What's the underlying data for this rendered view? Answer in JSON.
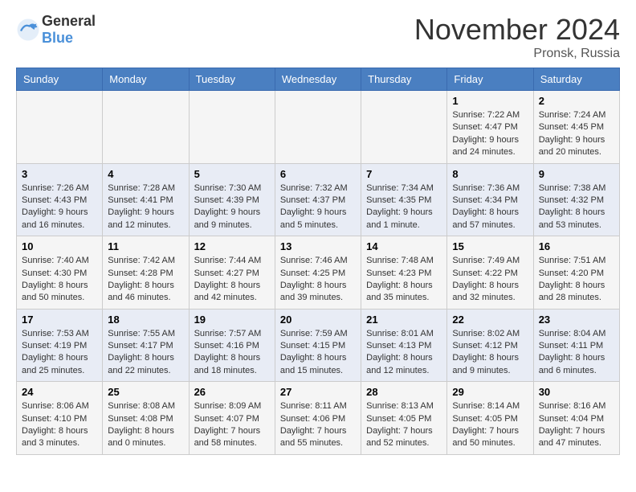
{
  "header": {
    "logo_general": "General",
    "logo_blue": "Blue",
    "month_title": "November 2024",
    "location": "Pronsk, Russia"
  },
  "days_of_week": [
    "Sunday",
    "Monday",
    "Tuesday",
    "Wednesday",
    "Thursday",
    "Friday",
    "Saturday"
  ],
  "weeks": [
    [
      {
        "day": "",
        "info": ""
      },
      {
        "day": "",
        "info": ""
      },
      {
        "day": "",
        "info": ""
      },
      {
        "day": "",
        "info": ""
      },
      {
        "day": "",
        "info": ""
      },
      {
        "day": "1",
        "info": "Sunrise: 7:22 AM\nSunset: 4:47 PM\nDaylight: 9 hours and 24 minutes."
      },
      {
        "day": "2",
        "info": "Sunrise: 7:24 AM\nSunset: 4:45 PM\nDaylight: 9 hours and 20 minutes."
      }
    ],
    [
      {
        "day": "3",
        "info": "Sunrise: 7:26 AM\nSunset: 4:43 PM\nDaylight: 9 hours and 16 minutes."
      },
      {
        "day": "4",
        "info": "Sunrise: 7:28 AM\nSunset: 4:41 PM\nDaylight: 9 hours and 12 minutes."
      },
      {
        "day": "5",
        "info": "Sunrise: 7:30 AM\nSunset: 4:39 PM\nDaylight: 9 hours and 9 minutes."
      },
      {
        "day": "6",
        "info": "Sunrise: 7:32 AM\nSunset: 4:37 PM\nDaylight: 9 hours and 5 minutes."
      },
      {
        "day": "7",
        "info": "Sunrise: 7:34 AM\nSunset: 4:35 PM\nDaylight: 9 hours and 1 minute."
      },
      {
        "day": "8",
        "info": "Sunrise: 7:36 AM\nSunset: 4:34 PM\nDaylight: 8 hours and 57 minutes."
      },
      {
        "day": "9",
        "info": "Sunrise: 7:38 AM\nSunset: 4:32 PM\nDaylight: 8 hours and 53 minutes."
      }
    ],
    [
      {
        "day": "10",
        "info": "Sunrise: 7:40 AM\nSunset: 4:30 PM\nDaylight: 8 hours and 50 minutes."
      },
      {
        "day": "11",
        "info": "Sunrise: 7:42 AM\nSunset: 4:28 PM\nDaylight: 8 hours and 46 minutes."
      },
      {
        "day": "12",
        "info": "Sunrise: 7:44 AM\nSunset: 4:27 PM\nDaylight: 8 hours and 42 minutes."
      },
      {
        "day": "13",
        "info": "Sunrise: 7:46 AM\nSunset: 4:25 PM\nDaylight: 8 hours and 39 minutes."
      },
      {
        "day": "14",
        "info": "Sunrise: 7:48 AM\nSunset: 4:23 PM\nDaylight: 8 hours and 35 minutes."
      },
      {
        "day": "15",
        "info": "Sunrise: 7:49 AM\nSunset: 4:22 PM\nDaylight: 8 hours and 32 minutes."
      },
      {
        "day": "16",
        "info": "Sunrise: 7:51 AM\nSunset: 4:20 PM\nDaylight: 8 hours and 28 minutes."
      }
    ],
    [
      {
        "day": "17",
        "info": "Sunrise: 7:53 AM\nSunset: 4:19 PM\nDaylight: 8 hours and 25 minutes."
      },
      {
        "day": "18",
        "info": "Sunrise: 7:55 AM\nSunset: 4:17 PM\nDaylight: 8 hours and 22 minutes."
      },
      {
        "day": "19",
        "info": "Sunrise: 7:57 AM\nSunset: 4:16 PM\nDaylight: 8 hours and 18 minutes."
      },
      {
        "day": "20",
        "info": "Sunrise: 7:59 AM\nSunset: 4:15 PM\nDaylight: 8 hours and 15 minutes."
      },
      {
        "day": "21",
        "info": "Sunrise: 8:01 AM\nSunset: 4:13 PM\nDaylight: 8 hours and 12 minutes."
      },
      {
        "day": "22",
        "info": "Sunrise: 8:02 AM\nSunset: 4:12 PM\nDaylight: 8 hours and 9 minutes."
      },
      {
        "day": "23",
        "info": "Sunrise: 8:04 AM\nSunset: 4:11 PM\nDaylight: 8 hours and 6 minutes."
      }
    ],
    [
      {
        "day": "24",
        "info": "Sunrise: 8:06 AM\nSunset: 4:10 PM\nDaylight: 8 hours and 3 minutes."
      },
      {
        "day": "25",
        "info": "Sunrise: 8:08 AM\nSunset: 4:08 PM\nDaylight: 8 hours and 0 minutes."
      },
      {
        "day": "26",
        "info": "Sunrise: 8:09 AM\nSunset: 4:07 PM\nDaylight: 7 hours and 58 minutes."
      },
      {
        "day": "27",
        "info": "Sunrise: 8:11 AM\nSunset: 4:06 PM\nDaylight: 7 hours and 55 minutes."
      },
      {
        "day": "28",
        "info": "Sunrise: 8:13 AM\nSunset: 4:05 PM\nDaylight: 7 hours and 52 minutes."
      },
      {
        "day": "29",
        "info": "Sunrise: 8:14 AM\nSunset: 4:05 PM\nDaylight: 7 hours and 50 minutes."
      },
      {
        "day": "30",
        "info": "Sunrise: 8:16 AM\nSunset: 4:04 PM\nDaylight: 7 hours and 47 minutes."
      }
    ]
  ]
}
